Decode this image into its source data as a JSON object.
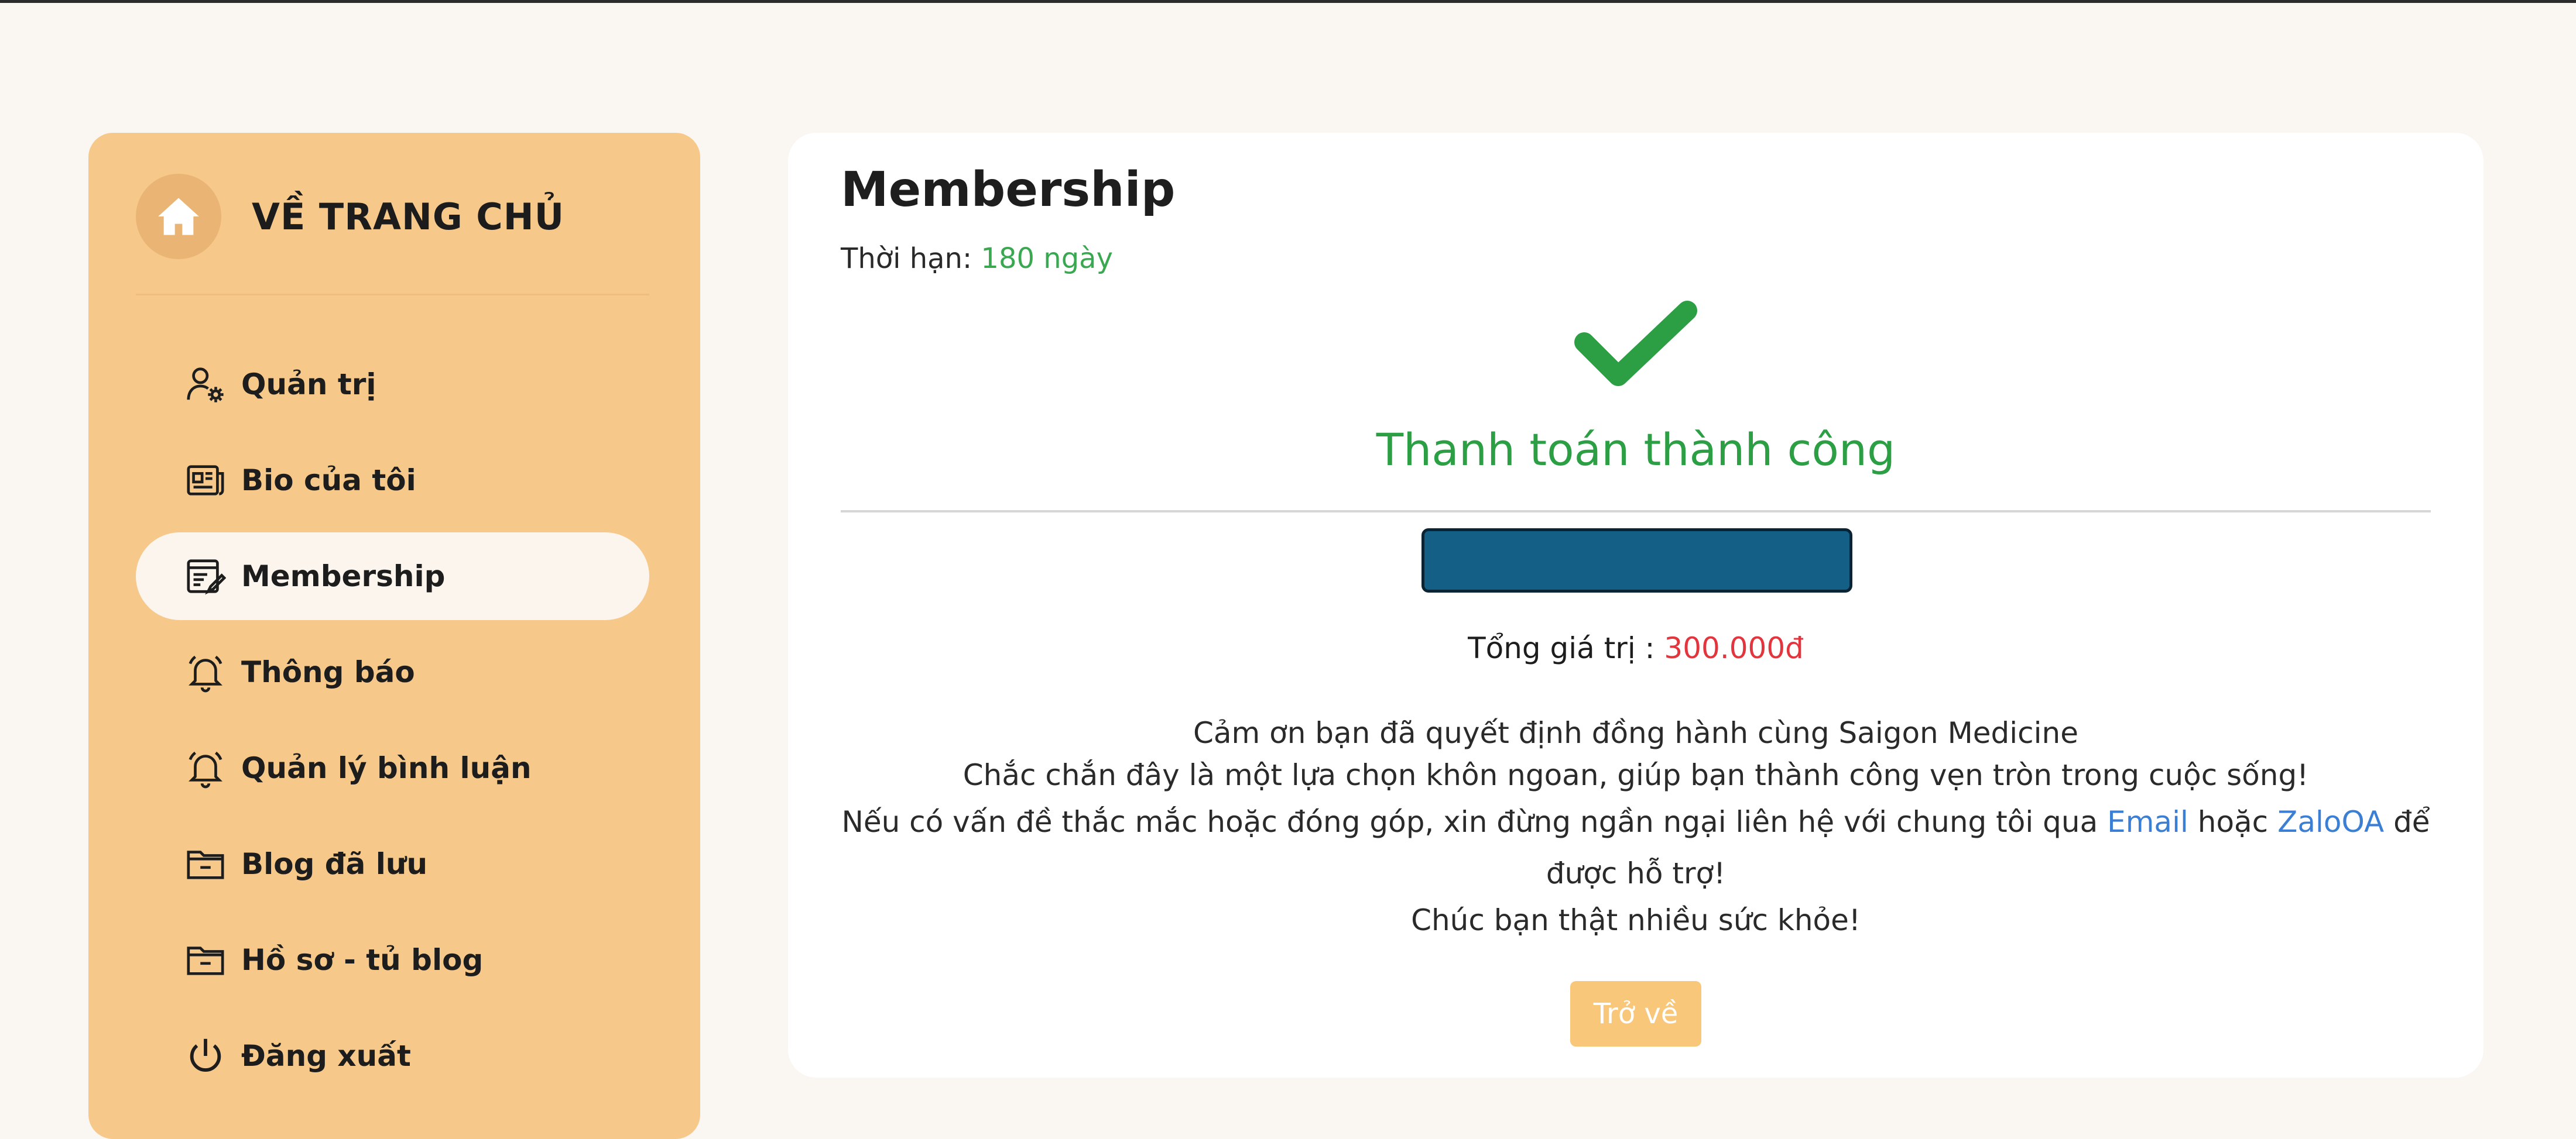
{
  "sidebar": {
    "home_label": "VỀ TRANG CHỦ",
    "items": [
      {
        "label": "Quản trị",
        "icon": "user-gear-icon"
      },
      {
        "label": "Bio của tôi",
        "icon": "newspaper-icon"
      },
      {
        "label": "Membership",
        "icon": "edit-document-icon",
        "active": true
      },
      {
        "label": "Thông báo",
        "icon": "bell-icon"
      },
      {
        "label": "Quản lý bình luận",
        "icon": "bell-icon"
      },
      {
        "label": "Blog đã lưu",
        "icon": "folder-icon"
      },
      {
        "label": "Hồ sơ - tủ blog",
        "icon": "folder-icon"
      },
      {
        "label": "Đăng xuất",
        "icon": "power-icon"
      }
    ]
  },
  "main": {
    "title": "Membership",
    "duration_label": "Thời hạn:",
    "duration_value": "180 ngày",
    "success_title": "Thanh toán thành công",
    "total_label": "Tổng giá trị :",
    "total_value": "300.000đ",
    "message": {
      "line1": "Cảm ơn bạn đã quyết định đồng hành cùng Saigon Medicine",
      "line2": "Chắc chắn đây là một lựa chọn khôn ngoan, giúp bạn thành công vẹn tròn trong cuộc sống!",
      "line3_prefix": "Nếu có vấn đề thắc mắc hoặc đóng góp, xin đừng ngần ngại liên hệ với chung tôi qua",
      "email_link": "Email",
      "line3_mid": "hoặc",
      "zalo_link": "ZaloOA",
      "line3_suffix": "để được hỗ trợ!",
      "line4": "Chúc bạn thật nhiều sức khỏe!"
    },
    "back_button": "Trở về"
  },
  "colors": {
    "sidebar_bg": "#f6c98a",
    "success_green": "#2c9f45",
    "price_red": "#e2353e",
    "link_blue": "#3b7fd4",
    "button_bg": "#f8c779"
  }
}
